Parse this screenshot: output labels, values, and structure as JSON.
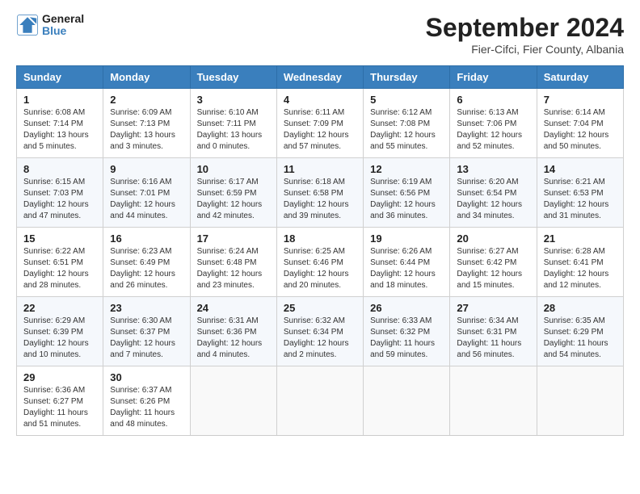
{
  "header": {
    "logo": {
      "line1": "General",
      "line2": "Blue"
    },
    "title": "September 2024",
    "subtitle": "Fier-Cifci, Fier County, Albania"
  },
  "days_header": [
    "Sunday",
    "Monday",
    "Tuesday",
    "Wednesday",
    "Thursday",
    "Friday",
    "Saturday"
  ],
  "weeks": [
    [
      {
        "day": "1",
        "sunrise": "Sunrise: 6:08 AM",
        "sunset": "Sunset: 7:14 PM",
        "daylight": "Daylight: 13 hours and 5 minutes."
      },
      {
        "day": "2",
        "sunrise": "Sunrise: 6:09 AM",
        "sunset": "Sunset: 7:13 PM",
        "daylight": "Daylight: 13 hours and 3 minutes."
      },
      {
        "day": "3",
        "sunrise": "Sunrise: 6:10 AM",
        "sunset": "Sunset: 7:11 PM",
        "daylight": "Daylight: 13 hours and 0 minutes."
      },
      {
        "day": "4",
        "sunrise": "Sunrise: 6:11 AM",
        "sunset": "Sunset: 7:09 PM",
        "daylight": "Daylight: 12 hours and 57 minutes."
      },
      {
        "day": "5",
        "sunrise": "Sunrise: 6:12 AM",
        "sunset": "Sunset: 7:08 PM",
        "daylight": "Daylight: 12 hours and 55 minutes."
      },
      {
        "day": "6",
        "sunrise": "Sunrise: 6:13 AM",
        "sunset": "Sunset: 7:06 PM",
        "daylight": "Daylight: 12 hours and 52 minutes."
      },
      {
        "day": "7",
        "sunrise": "Sunrise: 6:14 AM",
        "sunset": "Sunset: 7:04 PM",
        "daylight": "Daylight: 12 hours and 50 minutes."
      }
    ],
    [
      {
        "day": "8",
        "sunrise": "Sunrise: 6:15 AM",
        "sunset": "Sunset: 7:03 PM",
        "daylight": "Daylight: 12 hours and 47 minutes."
      },
      {
        "day": "9",
        "sunrise": "Sunrise: 6:16 AM",
        "sunset": "Sunset: 7:01 PM",
        "daylight": "Daylight: 12 hours and 44 minutes."
      },
      {
        "day": "10",
        "sunrise": "Sunrise: 6:17 AM",
        "sunset": "Sunset: 6:59 PM",
        "daylight": "Daylight: 12 hours and 42 minutes."
      },
      {
        "day": "11",
        "sunrise": "Sunrise: 6:18 AM",
        "sunset": "Sunset: 6:58 PM",
        "daylight": "Daylight: 12 hours and 39 minutes."
      },
      {
        "day": "12",
        "sunrise": "Sunrise: 6:19 AM",
        "sunset": "Sunset: 6:56 PM",
        "daylight": "Daylight: 12 hours and 36 minutes."
      },
      {
        "day": "13",
        "sunrise": "Sunrise: 6:20 AM",
        "sunset": "Sunset: 6:54 PM",
        "daylight": "Daylight: 12 hours and 34 minutes."
      },
      {
        "day": "14",
        "sunrise": "Sunrise: 6:21 AM",
        "sunset": "Sunset: 6:53 PM",
        "daylight": "Daylight: 12 hours and 31 minutes."
      }
    ],
    [
      {
        "day": "15",
        "sunrise": "Sunrise: 6:22 AM",
        "sunset": "Sunset: 6:51 PM",
        "daylight": "Daylight: 12 hours and 28 minutes."
      },
      {
        "day": "16",
        "sunrise": "Sunrise: 6:23 AM",
        "sunset": "Sunset: 6:49 PM",
        "daylight": "Daylight: 12 hours and 26 minutes."
      },
      {
        "day": "17",
        "sunrise": "Sunrise: 6:24 AM",
        "sunset": "Sunset: 6:48 PM",
        "daylight": "Daylight: 12 hours and 23 minutes."
      },
      {
        "day": "18",
        "sunrise": "Sunrise: 6:25 AM",
        "sunset": "Sunset: 6:46 PM",
        "daylight": "Daylight: 12 hours and 20 minutes."
      },
      {
        "day": "19",
        "sunrise": "Sunrise: 6:26 AM",
        "sunset": "Sunset: 6:44 PM",
        "daylight": "Daylight: 12 hours and 18 minutes."
      },
      {
        "day": "20",
        "sunrise": "Sunrise: 6:27 AM",
        "sunset": "Sunset: 6:42 PM",
        "daylight": "Daylight: 12 hours and 15 minutes."
      },
      {
        "day": "21",
        "sunrise": "Sunrise: 6:28 AM",
        "sunset": "Sunset: 6:41 PM",
        "daylight": "Daylight: 12 hours and 12 minutes."
      }
    ],
    [
      {
        "day": "22",
        "sunrise": "Sunrise: 6:29 AM",
        "sunset": "Sunset: 6:39 PM",
        "daylight": "Daylight: 12 hours and 10 minutes."
      },
      {
        "day": "23",
        "sunrise": "Sunrise: 6:30 AM",
        "sunset": "Sunset: 6:37 PM",
        "daylight": "Daylight: 12 hours and 7 minutes."
      },
      {
        "day": "24",
        "sunrise": "Sunrise: 6:31 AM",
        "sunset": "Sunset: 6:36 PM",
        "daylight": "Daylight: 12 hours and 4 minutes."
      },
      {
        "day": "25",
        "sunrise": "Sunrise: 6:32 AM",
        "sunset": "Sunset: 6:34 PM",
        "daylight": "Daylight: 12 hours and 2 minutes."
      },
      {
        "day": "26",
        "sunrise": "Sunrise: 6:33 AM",
        "sunset": "Sunset: 6:32 PM",
        "daylight": "Daylight: 11 hours and 59 minutes."
      },
      {
        "day": "27",
        "sunrise": "Sunrise: 6:34 AM",
        "sunset": "Sunset: 6:31 PM",
        "daylight": "Daylight: 11 hours and 56 minutes."
      },
      {
        "day": "28",
        "sunrise": "Sunrise: 6:35 AM",
        "sunset": "Sunset: 6:29 PM",
        "daylight": "Daylight: 11 hours and 54 minutes."
      }
    ],
    [
      {
        "day": "29",
        "sunrise": "Sunrise: 6:36 AM",
        "sunset": "Sunset: 6:27 PM",
        "daylight": "Daylight: 11 hours and 51 minutes."
      },
      {
        "day": "30",
        "sunrise": "Sunrise: 6:37 AM",
        "sunset": "Sunset: 6:26 PM",
        "daylight": "Daylight: 11 hours and 48 minutes."
      },
      null,
      null,
      null,
      null,
      null
    ]
  ]
}
